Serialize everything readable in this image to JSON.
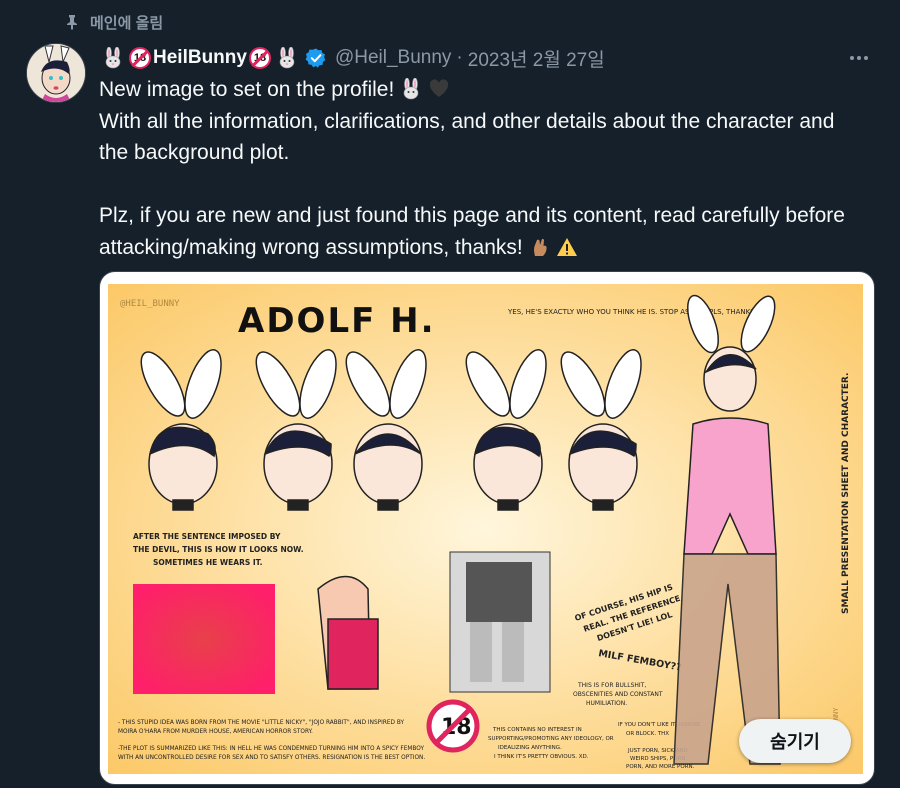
{
  "pinned_label": "메인에 올림",
  "author": {
    "display_name": "HeilBunny",
    "badge_text": "18",
    "handle": "@Heil_Bunny",
    "separator": "·",
    "date": "2023년 2월 27일"
  },
  "tweet": {
    "line1": "New image to set on the profile!",
    "line2": "With all the information, clarifications, and other details about the character and the background plot.",
    "line3": "Plz, if you are new and just found this page and its content, read carefully before attacking/making wrong assumptions, thanks!"
  },
  "media": {
    "watermark": "@HEIL_BUNNY",
    "title": "ADOLF H.",
    "note_top": "YES, HE'S EXACTLY WHO YOU THINK HE IS. STOP ASKING PLS, THANKS (?).",
    "side_label": "SMALL PRESENTATION SHEET AND CHARACTER.",
    "sentence_note_1": "AFTER THE SENTENCE IMPOSED BY",
    "sentence_note_2": "THE DEVIL, THIS IS HOW IT LOOKS NOW.",
    "sentence_note_3": "SOMETIMES HE WEARS IT.",
    "hip_note_1": "OF COURSE, HIS HIP IS",
    "hip_note_2": "REAL. THE REFERENCE",
    "hip_note_3": "DOESN'T LIE! LOL",
    "milf_label": "MILF FEMBOY??",
    "for_note_1": "THIS IS FOR BULLSHIT,",
    "for_note_2": "OBSCENITIES AND CONSTANT",
    "for_note_3": "HUMILIATION.",
    "bottom_note_1": "- THIS STUPID IDEA WAS BORN FROM THE MOVIE \"LITTLE NICKY\", \"JOJO RABBIT\", AND INSPIRED BY",
    "bottom_note_2": "MOIRA O'HARA FROM MURDER HOUSE, AMERICAN HORROR STORY.",
    "bottom_note_3": "-THE PLOT IS SUMMARIZED LIKE THIS: IN HELL HE WAS CONDEMNED TURNING HIM INTO A SPICY FEMBOY",
    "bottom_note_4": "WITH AN UNCONTROLLED DESIRE FOR SEX AND TO SATISFY OTHERS. RESIGNATION IS THE BEST OPTION.",
    "contain_note_1": "THIS CONTAINS NO INTEREST IN",
    "contain_note_2": "SUPPORTING/PROMOTING ANY IDEOLOGY, OR",
    "contain_note_3": "IDEALIZING ANYTHING.",
    "contain_note_4": "I THINK IT'S PRETTY OBVIOUS. XD.",
    "ignore_note_1": "IF YOU DON'T LIKE IT, IGNORE",
    "ignore_note_2": "OR BLOCK. THX",
    "porn_note_1": "JUST PORN, SICK AND",
    "porn_note_2": "WEIRD SHIPS, PORN,",
    "porn_note_3": "PORN, AND MORE PORN.",
    "big_badge": "18",
    "side_watermark": "@HEIL_BUNNY"
  },
  "hide_button_label": "숨기기",
  "colors": {
    "background": "#15202b",
    "text_primary": "#f7f9f9",
    "text_secondary": "#8b98a5",
    "verified": "#1d9bf0",
    "sheet_bg": "#fdd77a",
    "ear_pink": "#f4a6c8",
    "leotard_pink": "#f7a3cc"
  }
}
